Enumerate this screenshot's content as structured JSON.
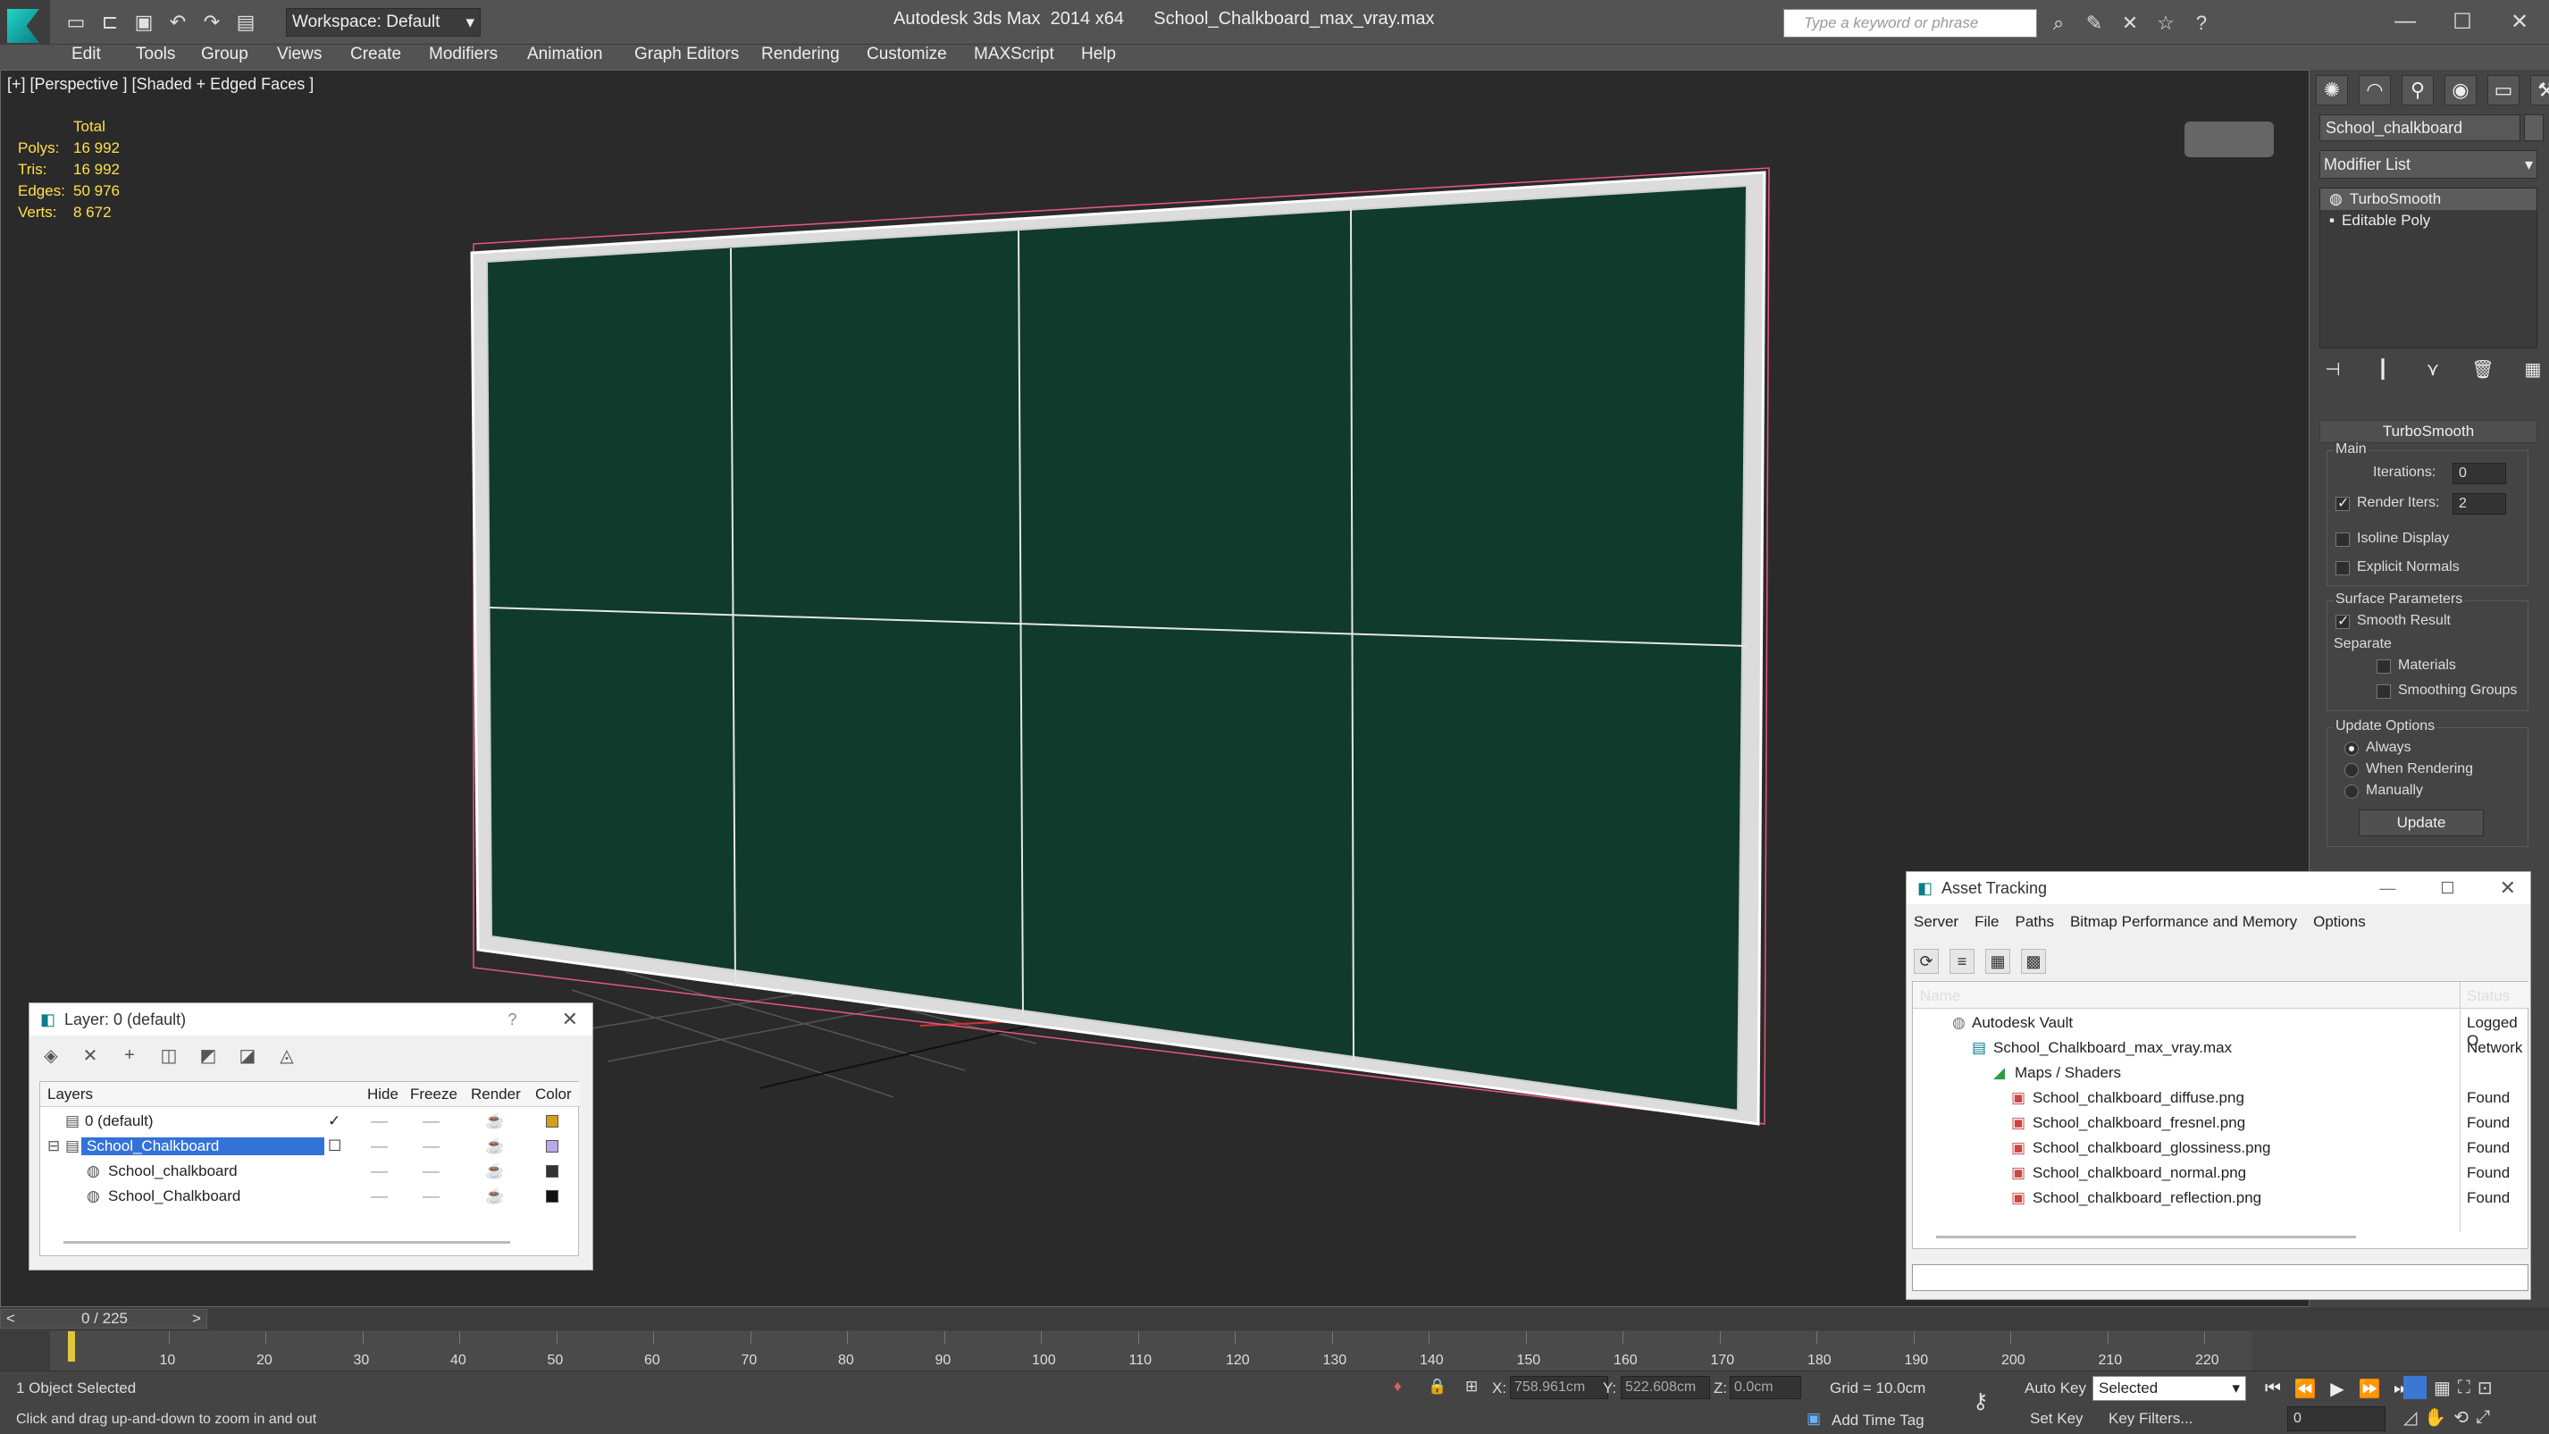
{
  "titlebar": {
    "app": "Autodesk 3ds Max  2014 x64",
    "file": "School_Chalkboard_max_vray.max",
    "workspace": "Workspace: Default",
    "search_placeholder": "Type a keyword or phrase"
  },
  "menu": [
    "Edit",
    "Tools",
    "Group",
    "Views",
    "Create",
    "Modifiers",
    "Animation",
    "Graph Editors",
    "Rendering",
    "Customize",
    "MAXScript",
    "Help"
  ],
  "viewport": {
    "label": "[+] [Perspective ] [Shaded + Edged Faces ]",
    "stats": {
      "header": "Total",
      "rows": [
        {
          "k": "Polys:",
          "v": "16 992"
        },
        {
          "k": "Tris:",
          "v": "16 992"
        },
        {
          "k": "Edges:",
          "v": "50 976"
        },
        {
          "k": "Verts:",
          "v": "8 672"
        }
      ]
    },
    "board_color": "#0f3a2c"
  },
  "command_panel": {
    "object_name": "School_chalkboard",
    "modifier_list": "Modifier List",
    "stack": [
      "TurboSmooth",
      "Editable Poly"
    ],
    "turbosmooth": {
      "title": "TurboSmooth",
      "main": "Main",
      "iterations_label": "Iterations:",
      "iterations": "0",
      "render_iters_label": "Render Iters:",
      "render_iters": "2",
      "isoline": "Isoline Display",
      "explicit": "Explicit Normals",
      "surface": "Surface Parameters",
      "smooth_result": "Smooth Result",
      "separate": "Separate",
      "materials": "Materials",
      "smoothing_groups": "Smoothing Groups",
      "update_options": "Update Options",
      "always": "Always",
      "when_rendering": "When Rendering",
      "manually": "Manually",
      "update": "Update"
    }
  },
  "layers_dialog": {
    "title": "Layer: 0 (default)",
    "help": "?",
    "cols": [
      "Layers",
      "Hide",
      "Freeze",
      "Render",
      "Color"
    ],
    "rows": [
      {
        "name": "0 (default)",
        "color": "#d4a017"
      },
      {
        "name": "School_Chalkboard",
        "color": "#b9a7e6"
      },
      {
        "name": "School_chalkboard",
        "color": "#333333"
      },
      {
        "name": "School_Chalkboard",
        "color": "#111111"
      }
    ]
  },
  "asset_tracking": {
    "title": "Asset Tracking",
    "menu": [
      "Server",
      "File",
      "Paths",
      "Bitmap Performance and Memory",
      "Options"
    ],
    "cols": [
      "Name",
      "Status"
    ],
    "rows": [
      {
        "name": "Autodesk Vault",
        "status": "Logged O"
      },
      {
        "name": "School_Chalkboard_max_vray.max",
        "status": "Network"
      },
      {
        "name": "Maps / Shaders",
        "status": ""
      },
      {
        "name": "School_chalkboard_diffuse.png",
        "status": "Found"
      },
      {
        "name": "School_chalkboard_fresnel.png",
        "status": "Found"
      },
      {
        "name": "School_chalkboard_glossiness.png",
        "status": "Found"
      },
      {
        "name": "School_chalkboard_normal.png",
        "status": "Found"
      },
      {
        "name": "School_chalkboard_reflection.png",
        "status": "Found"
      }
    ]
  },
  "timeline": {
    "frame": "0 / 225",
    "ticks": [
      "10",
      "20",
      "30",
      "40",
      "50",
      "60",
      "70",
      "80",
      "90",
      "100",
      "110",
      "120",
      "130",
      "140",
      "150",
      "160",
      "170",
      "180",
      "190",
      "200",
      "210",
      "220"
    ]
  },
  "status": {
    "selected": "1 Object Selected",
    "hint": "Click and drag up-and-down to zoom in and out",
    "x_label": "X:",
    "x": "758.961cm",
    "y_label": "Y:",
    "y": "522.608cm",
    "z_label": "Z:",
    "z": "0.0cm",
    "grid": "Grid = 10.0cm",
    "auto_key": "Auto Key",
    "set_key": "Set Key",
    "selected_dd": "Selected",
    "key_filters": "Key Filters...",
    "add_time_tag": "Add Time Tag",
    "frame_value": "0"
  }
}
